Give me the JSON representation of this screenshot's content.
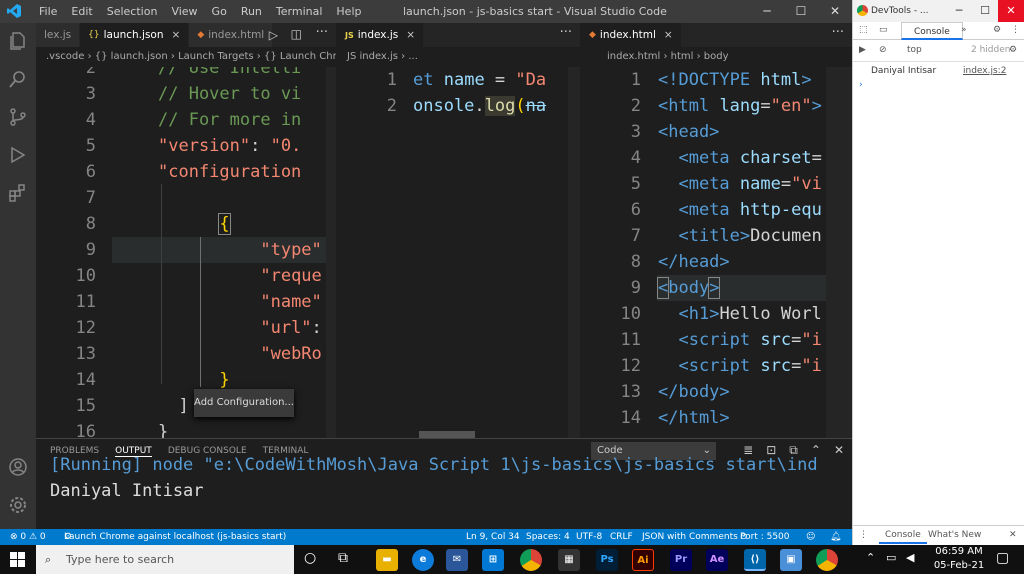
{
  "titlebar": {
    "menu": [
      "File",
      "Edit",
      "Selection",
      "View",
      "Go",
      "Run",
      "Terminal",
      "Help"
    ],
    "window_title": "launch.json - js-basics start - Visual Studio Code"
  },
  "pane1": {
    "tabs": [
      {
        "label": "lex.js",
        "icon": "js"
      },
      {
        "label": "launch.json",
        "icon": "json",
        "active": true,
        "close": "×"
      },
      {
        "label": "index.html",
        "icon": "html"
      }
    ],
    "breadcrumb": ".vscode › {} launch.json › Launch Targets › {} Launch Chrome a",
    "line_numbers": [
      "2",
      "3",
      "4",
      "5",
      "6",
      "7",
      "8",
      "9",
      "10",
      "11",
      "12",
      "13",
      "14",
      "15",
      "16"
    ],
    "add_config_label": "Add Configuration..."
  },
  "pane2": {
    "tab": {
      "label": "index.js",
      "close": "×"
    },
    "breadcrumb": "JS index.js › ...",
    "line_numbers": [
      "1",
      "2"
    ]
  },
  "pane3": {
    "tab": {
      "label": "index.html",
      "close": "×"
    },
    "breadcrumb": "index.html › html › body",
    "line_numbers": [
      "1",
      "2",
      "3",
      "4",
      "5",
      "6",
      "7",
      "8",
      "9",
      "10",
      "11",
      "12",
      "13",
      "14"
    ]
  },
  "panel": {
    "tabs": [
      "PROBLEMS",
      "OUTPUT",
      "DEBUG CONSOLE",
      "TERMINAL"
    ],
    "active_tab": "OUTPUT",
    "select_value": "Code",
    "output_lines": [
      "[Running] node \"e:\\CodeWithMosh\\Java Script 1\\js-basics\\js-basics start\\ind",
      "Daniyal Intisar"
    ]
  },
  "statusbar": {
    "problems": "⊗ 0 ⚠ 0",
    "debug": "Launch Chrome against localhost (js-basics start)",
    "position": "Ln 9, Col 34",
    "spaces": "Spaces: 4",
    "encoding": "UTF-8",
    "eol": "CRLF",
    "language": "JSON with Comments",
    "port": "Port : 5500"
  },
  "devtools": {
    "title": "DevTools - ...",
    "tab": "Console",
    "context": "top",
    "hidden": "2 hidden",
    "log_text": "Daniyal Intisar",
    "log_source": "index.js:2",
    "bottom_tabs": [
      "Console",
      "What's New"
    ]
  },
  "taskbar": {
    "search_placeholder": "Type here to search",
    "time": "06:59 AM",
    "date": "05-Feb-21",
    "apps": [
      "Ps",
      "Ai",
      "Pr",
      "Ae"
    ]
  },
  "colors": {
    "statusbar": "#007acc",
    "titlebar": "#3c3c3c",
    "activitybar": "#333333"
  }
}
